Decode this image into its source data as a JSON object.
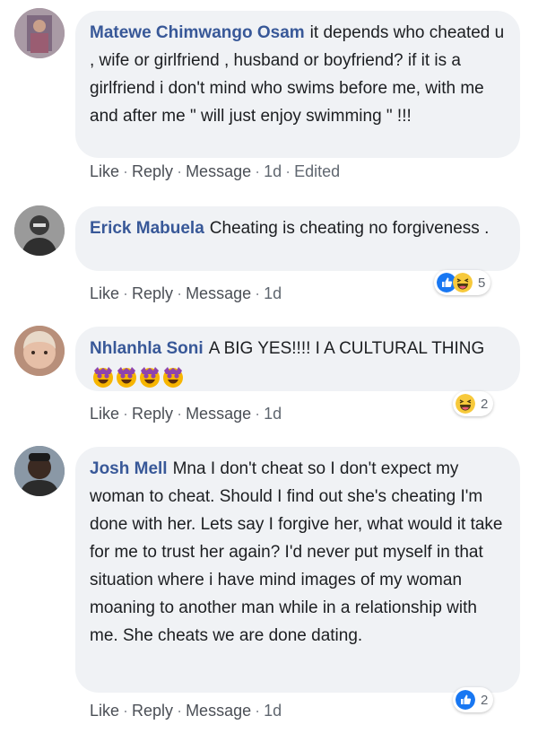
{
  "actions": {
    "like": "Like",
    "reply": "Reply",
    "message": "Message",
    "sep": "·"
  },
  "comments": [
    {
      "author": "Matewe Chimwango Osam",
      "text": "it depends who cheated u , wife or girlfriend , husband or boyfriend? if it is a girlfriend i don't mind who swims before me, with me and after me \" will just enjoy swimming \" !!!",
      "time": "1d",
      "edited": "Edited"
    },
    {
      "author": "Erick Mabuela",
      "text": "Cheating is cheating no forgiveness .",
      "time": "1d",
      "reactions": {
        "icons": [
          "like-icon",
          "laugh-icon"
        ],
        "count": "5"
      }
    },
    {
      "author": "Nhlanhla Soni",
      "text": "A BIG YES!!!! I A CULTURAL THING",
      "time": "1d",
      "reactions": {
        "icons": [
          "laugh-icon"
        ],
        "count": "2"
      }
    },
    {
      "author": "Josh Mell",
      "text": "Mna I don't cheat so I don't expect my woman to cheat. Should I find out she's cheating I'm done with her. Lets say I forgive her, what would it take for me to trust her again? I'd never put myself in that situation where i have mind images of my woman moaning to another man while in a relationship with me. She cheats we are done dating.",
      "time": "1d",
      "reactions": {
        "icons": [
          "like-icon"
        ],
        "count": "2"
      }
    }
  ]
}
